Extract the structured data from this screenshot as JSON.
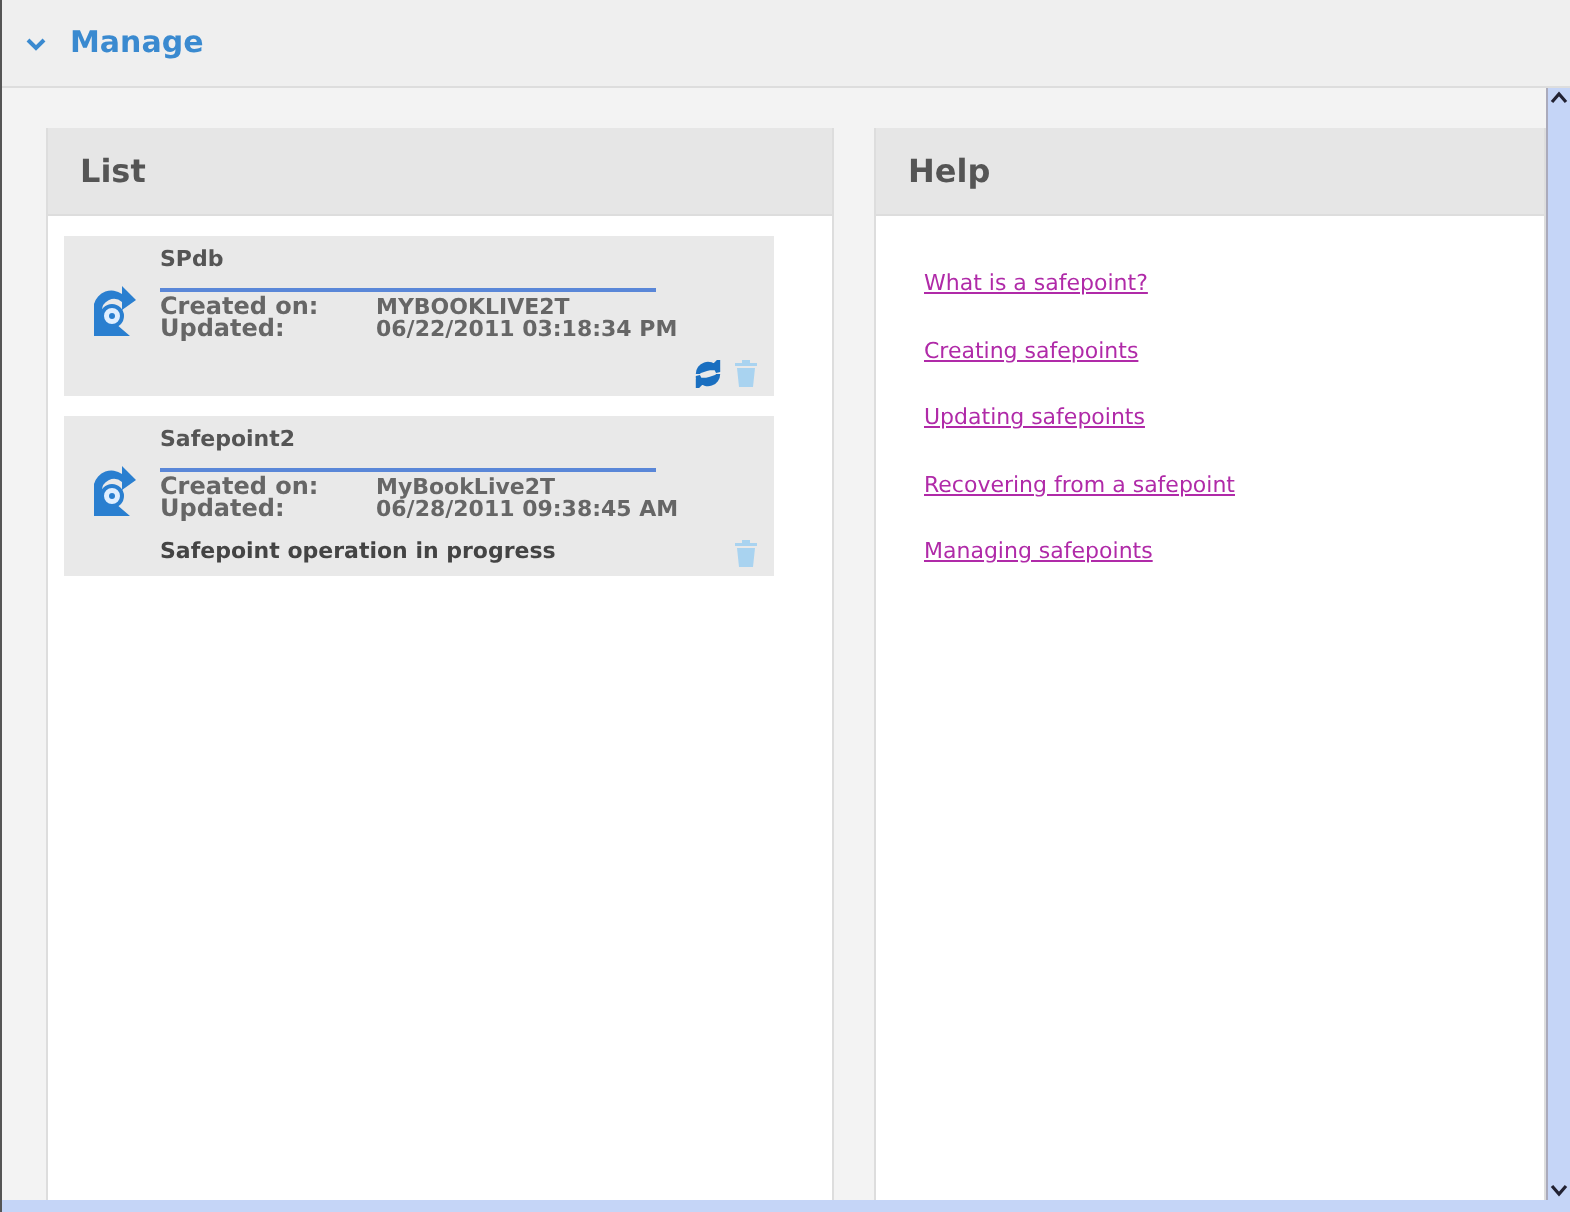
{
  "section": {
    "title": "Manage",
    "expanded": true
  },
  "list": {
    "title": "List",
    "items": [
      {
        "name": "SPdb",
        "fields": [
          {
            "label": "Created on:",
            "value": "MYBOOKLIVE2T"
          },
          {
            "label": "Updated:",
            "value": "06/22/2011 03:18:34 PM"
          }
        ],
        "actions": [
          {
            "kind": "refresh"
          },
          {
            "kind": "delete"
          }
        ]
      },
      {
        "name": "Safepoint2",
        "fields": [
          {
            "label": "Created on:",
            "value": "MyBookLive2T"
          },
          {
            "label": "Updated:",
            "value": "06/28/2011 09:38:45 AM"
          }
        ],
        "status": "Safepoint operation in progress",
        "actions": [
          {
            "kind": "delete"
          }
        ]
      }
    ]
  },
  "help": {
    "title": "Help",
    "links": [
      "What is a safepoint?",
      "Creating safepoints",
      "Updating safepoints",
      "Recovering from a safepoint",
      "Managing safepoints"
    ]
  }
}
